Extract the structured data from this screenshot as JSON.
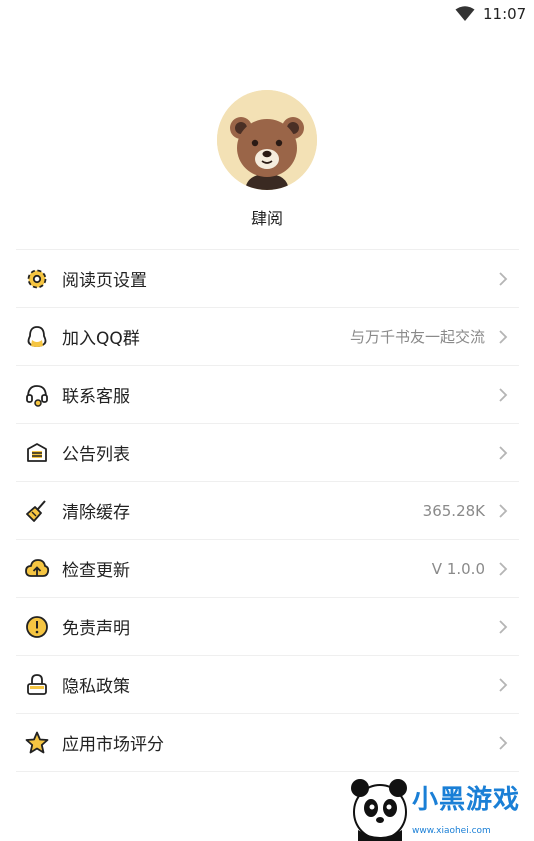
{
  "status_bar": {
    "time": "11:07",
    "wifi_icon": "wifi-icon"
  },
  "profile": {
    "avatar_icon": "bear-avatar-icon",
    "name": "肆阅"
  },
  "accent_color": "#f5c542",
  "menu": {
    "items": [
      {
        "icon": "gear-icon",
        "label": "阅读页设置",
        "value": ""
      },
      {
        "icon": "qq-icon",
        "label": "加入QQ群",
        "value": "与万千书友一起交流"
      },
      {
        "icon": "headset-icon",
        "label": "联系客服",
        "value": ""
      },
      {
        "icon": "announcement-icon",
        "label": "公告列表",
        "value": ""
      },
      {
        "icon": "broom-icon",
        "label": "清除缓存",
        "value": "365.28K"
      },
      {
        "icon": "cloud-upload-icon",
        "label": "检查更新",
        "value": "V 1.0.0"
      },
      {
        "icon": "exclamation-icon",
        "label": "免责声明",
        "value": ""
      },
      {
        "icon": "lock-icon",
        "label": "隐私政策",
        "value": ""
      },
      {
        "icon": "star-icon",
        "label": "应用市场评分",
        "value": ""
      }
    ]
  },
  "watermark": {
    "logo_icon": "panda-logo-icon",
    "text": "小黑游戏",
    "url": "www.xiaohei.com"
  }
}
